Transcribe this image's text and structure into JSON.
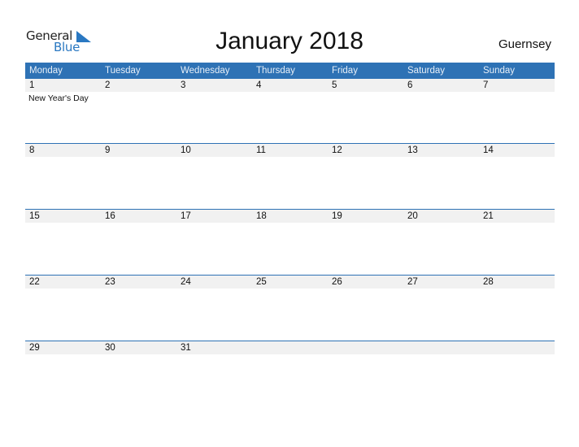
{
  "logo": {
    "line1": "General",
    "line2": "Blue"
  },
  "title": "January 2018",
  "country": "Guernsey",
  "colors": {
    "header_bg": "#2e72b5",
    "date_strip_bg": "#f1f1f1",
    "logo_blue": "#2a78c2"
  },
  "weekdays": [
    "Monday",
    "Tuesday",
    "Wednesday",
    "Thursday",
    "Friday",
    "Saturday",
    "Sunday"
  ],
  "weeks": [
    {
      "days": [
        "1",
        "2",
        "3",
        "4",
        "5",
        "6",
        "7"
      ],
      "events": [
        "New Year's Day",
        "",
        "",
        "",
        "",
        "",
        ""
      ]
    },
    {
      "days": [
        "8",
        "9",
        "10",
        "11",
        "12",
        "13",
        "14"
      ],
      "events": [
        "",
        "",
        "",
        "",
        "",
        "",
        ""
      ]
    },
    {
      "days": [
        "15",
        "16",
        "17",
        "18",
        "19",
        "20",
        "21"
      ],
      "events": [
        "",
        "",
        "",
        "",
        "",
        "",
        ""
      ]
    },
    {
      "days": [
        "22",
        "23",
        "24",
        "25",
        "26",
        "27",
        "28"
      ],
      "events": [
        "",
        "",
        "",
        "",
        "",
        "",
        ""
      ]
    },
    {
      "days": [
        "29",
        "30",
        "31",
        "",
        "",
        "",
        ""
      ],
      "events": [
        "",
        "",
        "",
        "",
        "",
        "",
        ""
      ]
    }
  ]
}
